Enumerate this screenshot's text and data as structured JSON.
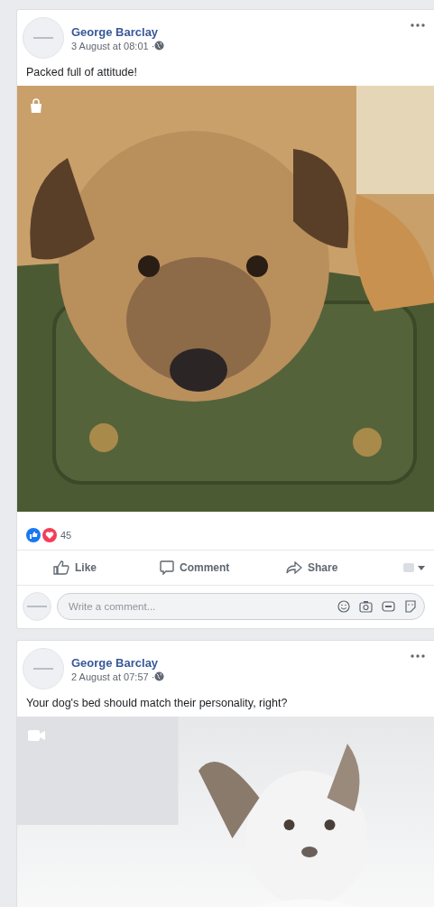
{
  "posts": [
    {
      "author": "George Barclay",
      "time": "3 August at 08:01 · ",
      "text": "Packed full of attitude!",
      "reactions": {
        "count": "45"
      },
      "actions": [
        {
          "kind": "like",
          "label": "Like"
        },
        {
          "kind": "comment",
          "label": "Comment"
        },
        {
          "kind": "share",
          "label": "Share"
        }
      ],
      "comment_box": {
        "placeholder": "Write a comment..."
      }
    },
    {
      "author": "George Barclay",
      "time": "2 August at 07:57 · ",
      "text": "Your dog's bed should match their personality, right?",
      "media": {
        "kind": "video"
      }
    }
  ]
}
